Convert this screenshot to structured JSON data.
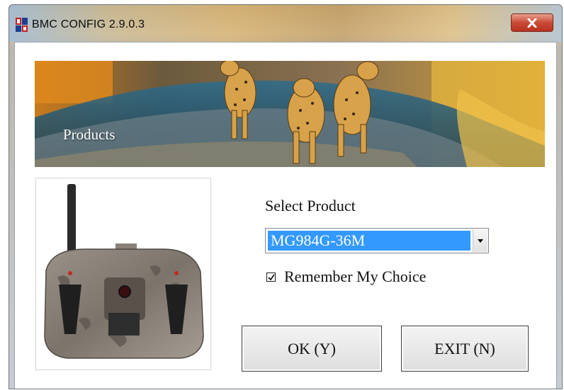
{
  "window": {
    "title": "BMC CONFIG 2.9.0.3",
    "close_label": "close"
  },
  "banner": {
    "title": "Products"
  },
  "form": {
    "select_label": "Select Product",
    "selected_product": "MG984G-36M",
    "remember_label": "Remember My Choice",
    "remember_checked": true,
    "ok_label": "OK (Y)",
    "exit_label": "EXIT (N)"
  },
  "icons": {
    "app": "app-logo-icon",
    "close": "close-icon",
    "dropdown": "chevron-down-icon",
    "check": "checkmark-icon"
  }
}
